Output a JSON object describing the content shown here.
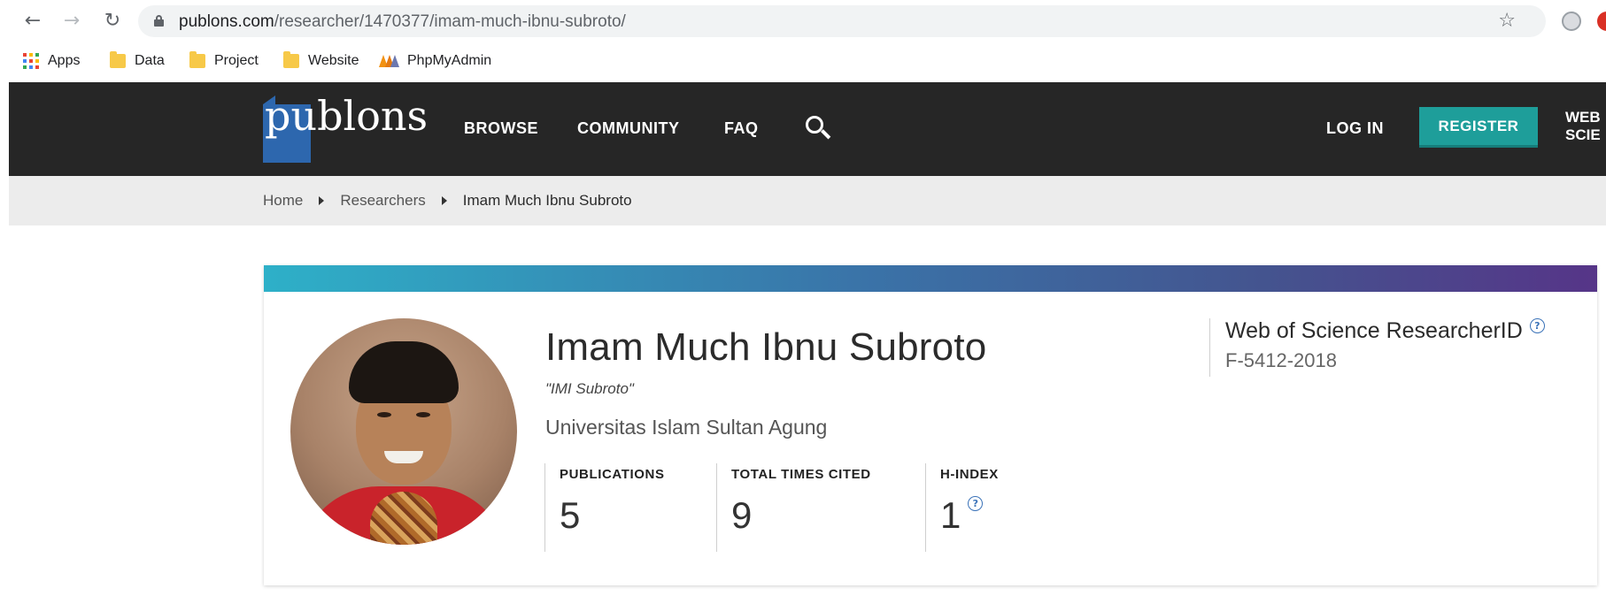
{
  "browser": {
    "url_host": "publons.com",
    "url_path": "/researcher/1470377/imam-much-ibnu-subroto/",
    "bookmarks": [
      {
        "label": "Apps",
        "icon": "apps-grid-icon"
      },
      {
        "label": "Data",
        "icon": "folder-icon"
      },
      {
        "label": "Project",
        "icon": "folder-icon"
      },
      {
        "label": "Website",
        "icon": "folder-icon"
      },
      {
        "label": "PhpMyAdmin",
        "icon": "phpmyadmin-icon"
      }
    ]
  },
  "header": {
    "logo_text": "publons",
    "nav": [
      "BROWSE",
      "COMMUNITY",
      "FAQ"
    ],
    "login_label": "LOG IN",
    "register_label": "REGISTER",
    "wos_label": "WEB\nSCIE",
    "colors": {
      "background": "#262626",
      "register": "#1e9e9a",
      "logo_blue": "#2d67ae"
    }
  },
  "breadcrumb": [
    "Home",
    "Researchers",
    "Imam Much Ibnu Subroto"
  ],
  "profile": {
    "name": "Imam Much Ibnu Subroto",
    "nickname": "\"IMI Subroto\"",
    "institution": "Universitas Islam Sultan Agung",
    "metrics": [
      {
        "label": "PUBLICATIONS",
        "value": "5"
      },
      {
        "label": "TOTAL TIMES CITED",
        "value": "9"
      },
      {
        "label": "H-INDEX",
        "value": "1"
      }
    ],
    "researcher_id_label": "Web of Science ResearcherID",
    "researcher_id": "F-5412-2018",
    "help_glyph": "?"
  }
}
